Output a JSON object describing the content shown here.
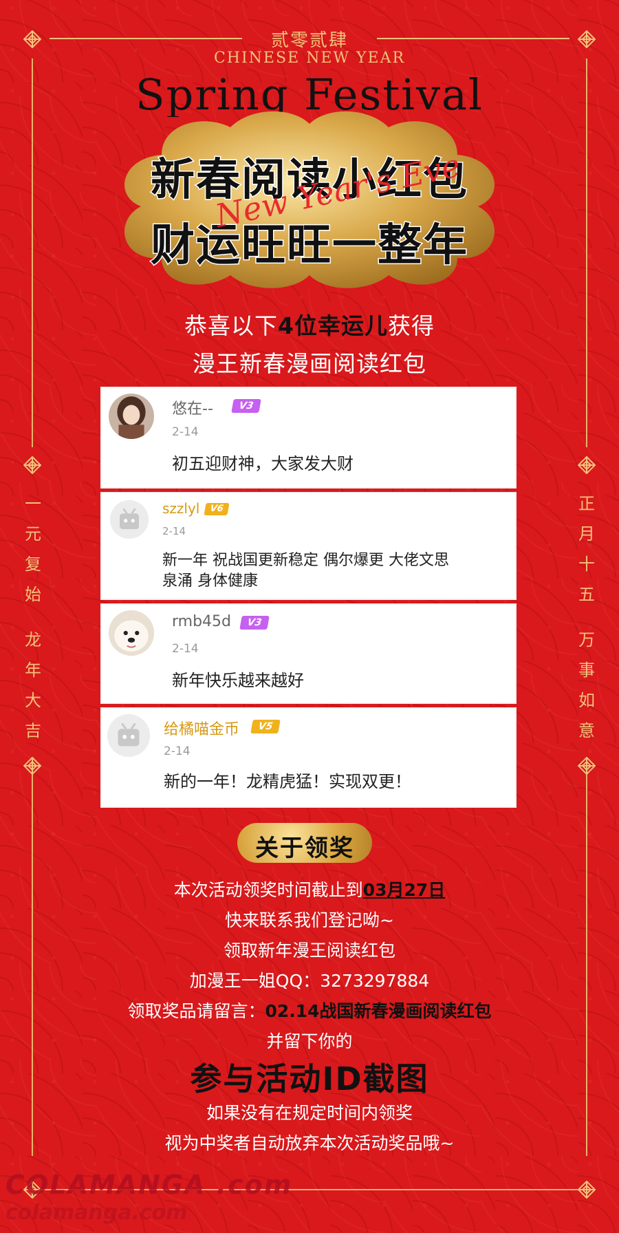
{
  "header": {
    "year_cn": "贰零贰肆",
    "subtitle_en": "CHINESE NEW YEAR",
    "spring_festival": "Spring Festival",
    "title_line1": "新春阅读小红包",
    "title_line2": "财运旺旺一整年",
    "script_text": "New Year's Eve"
  },
  "congrats": {
    "line1_prefix": "恭喜以下",
    "line1_bold": "4位幸运儿",
    "line1_suffix": "获得",
    "line2": "漫王新春漫画阅读红包"
  },
  "winners": [
    {
      "name": "悠在--",
      "level": "V3",
      "date": "2-14",
      "message": "初五迎财神，大家发大财"
    },
    {
      "name": "szzlyl",
      "level": "V6",
      "date": "2-14",
      "message_line1": "新一年 祝战国更新稳定 偶尔爆更 大佬文思",
      "message_line2": "泉涌 身体健康"
    },
    {
      "name": "rmb45d",
      "level": "V3",
      "date": "2-14",
      "message": "新年快乐越来越好"
    },
    {
      "name": "给橘喵金币",
      "level": "V5",
      "date": "2-14",
      "message": "新的一年！龙精虎猛！实现双更！"
    }
  ],
  "prize": {
    "heading": "关于领奖",
    "deadline_prefix": "本次活动领奖时间截止到",
    "deadline_date": "03月27日",
    "line_contact": "快来联系我们登记呦~",
    "line_get": "领取新年漫王阅读红包",
    "line_qq": "加漫王一姐QQ：3273297884",
    "note_prefix": "领取奖品请留言：",
    "note_bold": "02.14战国新春漫画阅读红包",
    "line_leave": "并留下你的",
    "big_line": "参与活动ID截图",
    "line_if": "如果没有在规定时间内领奖",
    "line_forfeit": "视为中奖者自动放弃本次活动奖品哦~"
  },
  "side": {
    "left": [
      "一",
      "元",
      "复",
      "始",
      "龙",
      "年",
      "大",
      "吉"
    ],
    "right": [
      "正",
      "月",
      "十",
      "五",
      "万",
      "事",
      "如",
      "意"
    ]
  },
  "watermark": {
    "line1": "COLAMANGA .com",
    "line2": "colamanga.com"
  },
  "colors": {
    "background": "#d9191c",
    "gold": "#f1c27b",
    "level_purple": "#c660f0",
    "level_gold": "#f0b21c"
  }
}
